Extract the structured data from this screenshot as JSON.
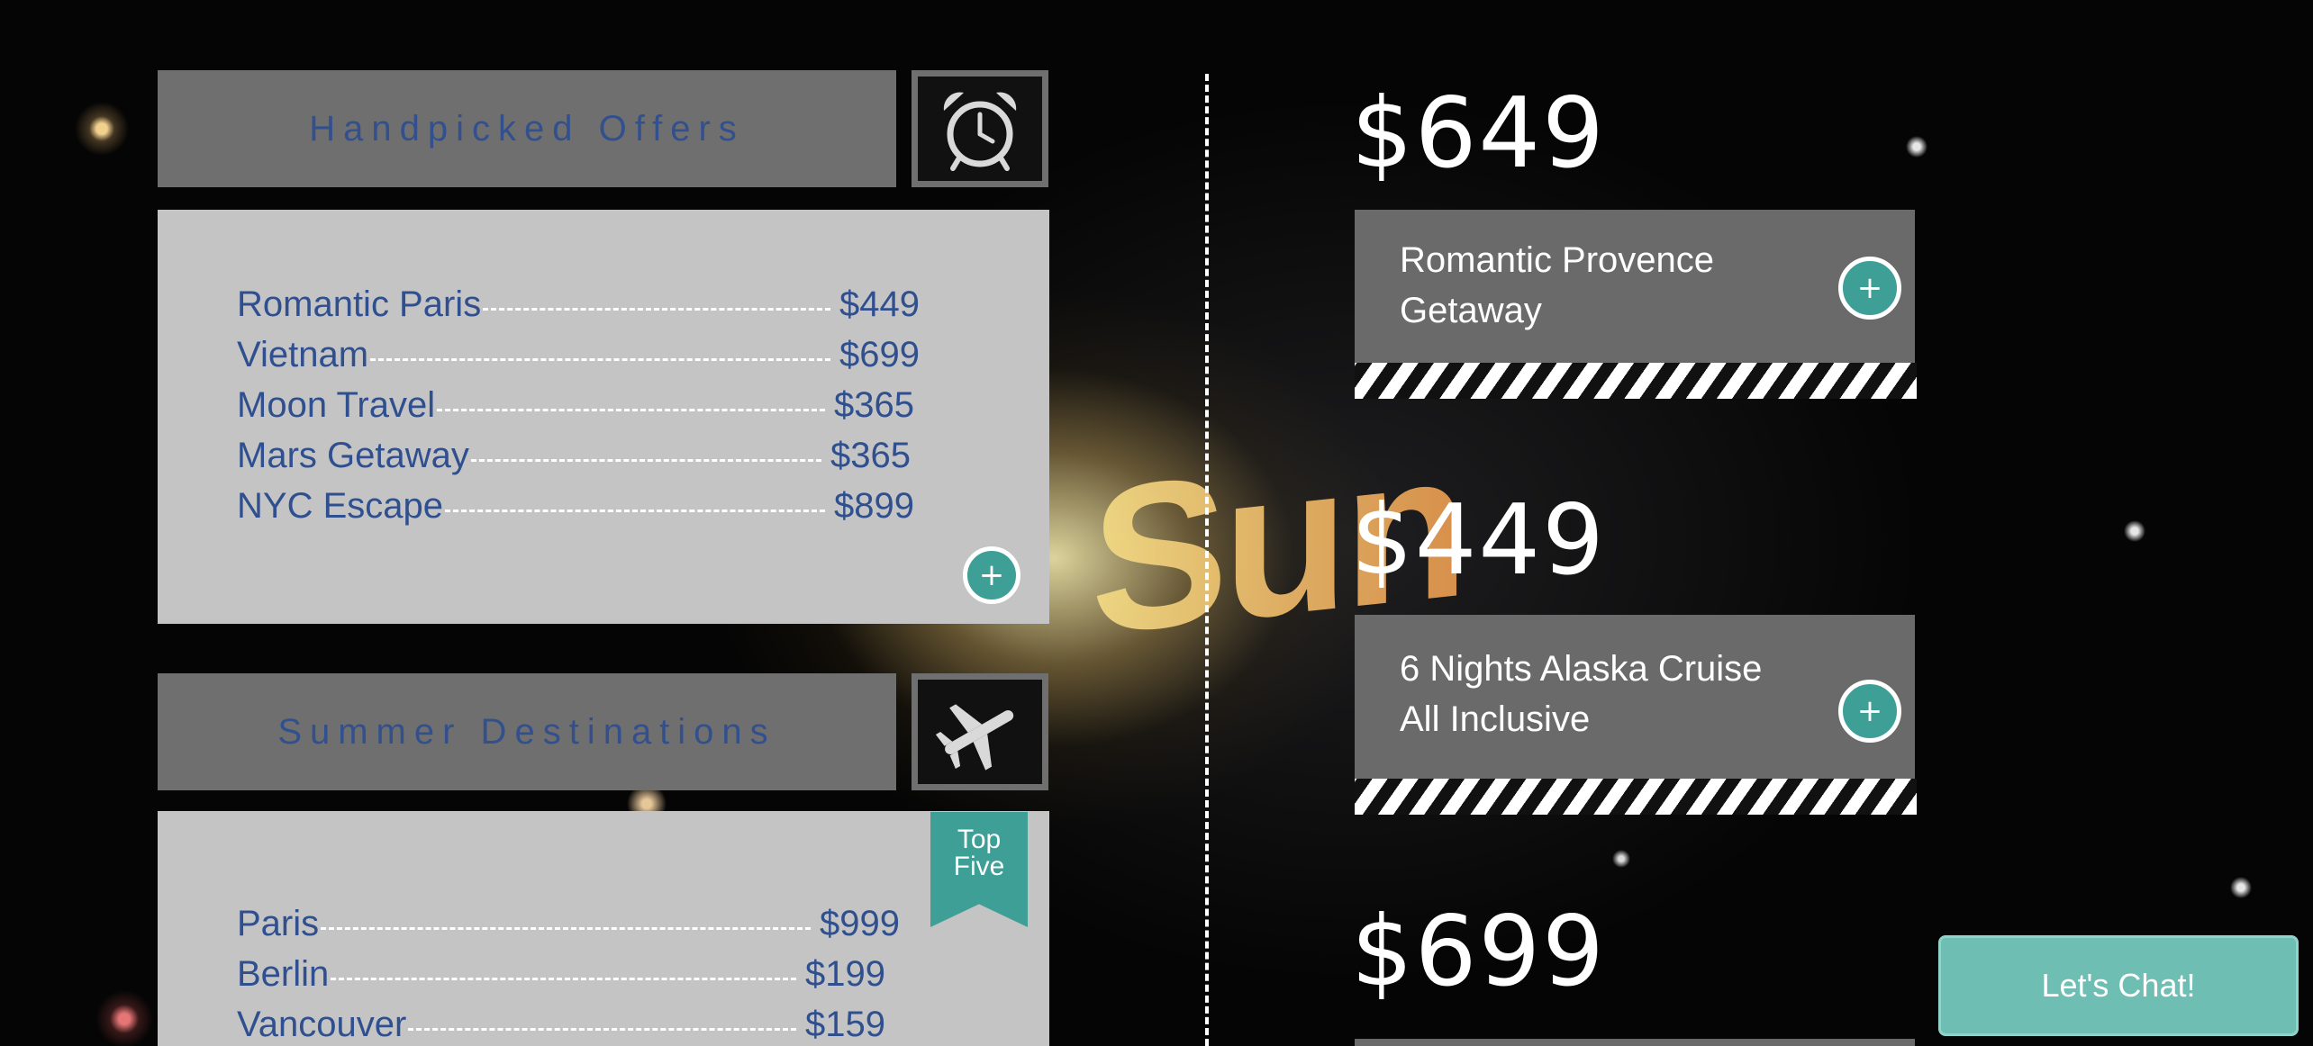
{
  "handpicked": {
    "title": "Handpicked Offers",
    "icon": "alarm-clock-icon",
    "items": [
      {
        "name": "Romantic Paris",
        "price": "$449"
      },
      {
        "name": "Vietnam",
        "price": "$699"
      },
      {
        "name": "Moon Travel",
        "price": "$365"
      },
      {
        "name": "Mars Getaway",
        "price": "$365"
      },
      {
        "name": "NYC Escape",
        "price": "$899"
      }
    ],
    "add_label": "+"
  },
  "summer": {
    "title": "Summer Destinations",
    "icon": "airplane-icon",
    "ribbon_line1": "Top",
    "ribbon_line2": "Five",
    "items": [
      {
        "name": "Paris",
        "price": "$999"
      },
      {
        "name": "Berlin",
        "price": "$199"
      },
      {
        "name": "Vancouver",
        "price": "$159"
      }
    ]
  },
  "background_text": "Sun",
  "offers": [
    {
      "price": "$649",
      "title_line1": "Romantic Provence",
      "title_line2": "Getaway",
      "add_label": "+"
    },
    {
      "price": "$449",
      "title_line1": "6 Nights Alaska Cruise",
      "title_line2": "All Inclusive",
      "add_label": "+"
    },
    {
      "price": "$699"
    }
  ],
  "chat": {
    "label": "Let's Chat!"
  },
  "colors": {
    "accent": "#3e9f97",
    "panel": "#6f6f6f",
    "list_panel": "#c4c4c4",
    "text_blue": "#2f4f8f",
    "chat": "#6fbeb4"
  }
}
